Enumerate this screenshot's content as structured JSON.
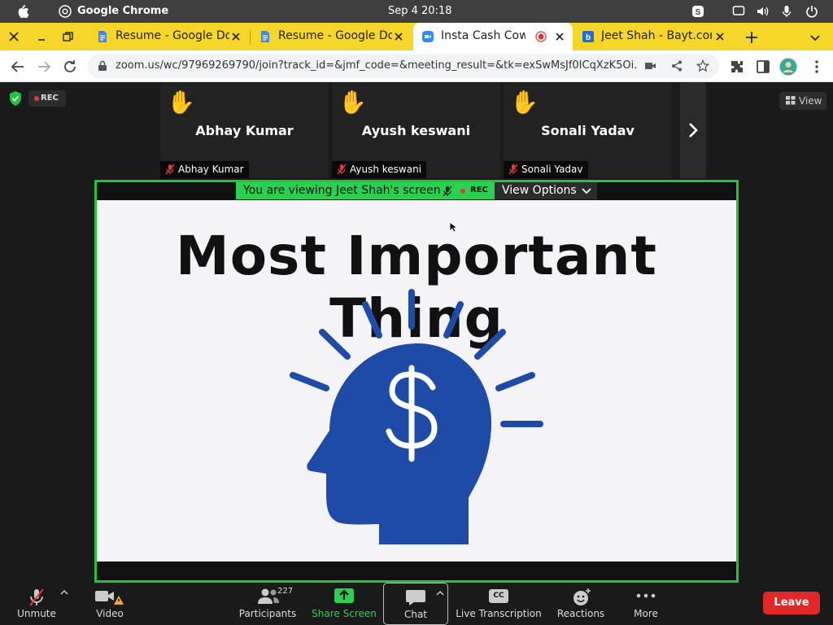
{
  "os": {
    "app_name": "Google Chrome",
    "clock": "Sep 4  20:18"
  },
  "tabs": [
    {
      "title": "Resume - Google Do",
      "active": false
    },
    {
      "title": "Resume - Google Do",
      "active": false
    },
    {
      "title": "Insta Cash Cow \\",
      "active": true
    },
    {
      "title": "Jeet Shah - Bayt.cor",
      "active": false
    }
  ],
  "toolbar": {
    "url": "zoom.us/wc/97969269790/join?track_id=&jmf_code=&meeting_result=&tk=exSwMsJf0ICqXzK5Oi..."
  },
  "meeting": {
    "rec_label": "REC",
    "view_label": "View",
    "participants_tiles": [
      {
        "name": "Abhay Kumar",
        "hand": "✋"
      },
      {
        "name": "Ayush keswani",
        "hand": "✋"
      },
      {
        "name": "Sonali Yadav",
        "hand": "✋"
      }
    ],
    "viewing_text": "You are viewing Jeet Shah's screen",
    "viewing_rec": "REC",
    "view_options_label": "View Options",
    "slide_title": "Most Important Thing"
  },
  "controls": {
    "unmute": "Unmute",
    "video": "Video",
    "participants": "Participants",
    "participants_count": "227",
    "share_screen": "Share Screen",
    "chat": "Chat",
    "live_transcription": "Live Transcription",
    "cc_badge": "CC",
    "reactions": "Reactions",
    "more": "More",
    "leave": "Leave"
  },
  "colors": {
    "share_green": "#23c43c",
    "slide_blue": "#1e4aa8",
    "leave_red": "#e02828",
    "tab_bar": "#f7d62a"
  }
}
